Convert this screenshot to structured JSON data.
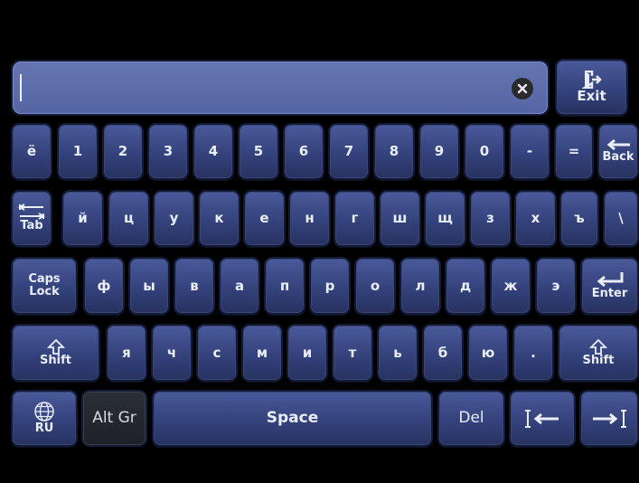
{
  "input": {
    "value": ""
  },
  "row0": [
    "ё",
    "1",
    "2",
    "3",
    "4",
    "5",
    "6",
    "7",
    "8",
    "9",
    "0",
    "-",
    "="
  ],
  "row1": [
    "й",
    "ц",
    "у",
    "к",
    "е",
    "н",
    "г",
    "ш",
    "щ",
    "з",
    "х",
    "ъ",
    "\\"
  ],
  "row2": [
    "ф",
    "ы",
    "в",
    "а",
    "п",
    "р",
    "о",
    "л",
    "д",
    "ж",
    "э"
  ],
  "row3": [
    "я",
    "ч",
    "с",
    "м",
    "и",
    "т",
    "ь",
    "б",
    "ю",
    "."
  ],
  "keys": {
    "exit": "Exit",
    "back": "Back",
    "tab": "Tab",
    "caps_line1": "Caps",
    "caps_line2": "Lock",
    "enter": "Enter",
    "shift": "Shift",
    "lang": "RU",
    "altgr": "Alt Gr",
    "space": "Space",
    "del": "Del"
  },
  "icons": {
    "clear": "clear-icon",
    "exit": "exit-door-icon",
    "back": "backspace-arrow-icon",
    "tab": "tab-arrows-icon",
    "enter": "enter-return-icon",
    "shift": "shift-arrow-icon",
    "globe": "globe-icon",
    "cursor_home": "cursor-left-icon",
    "cursor_end": "cursor-right-icon"
  }
}
